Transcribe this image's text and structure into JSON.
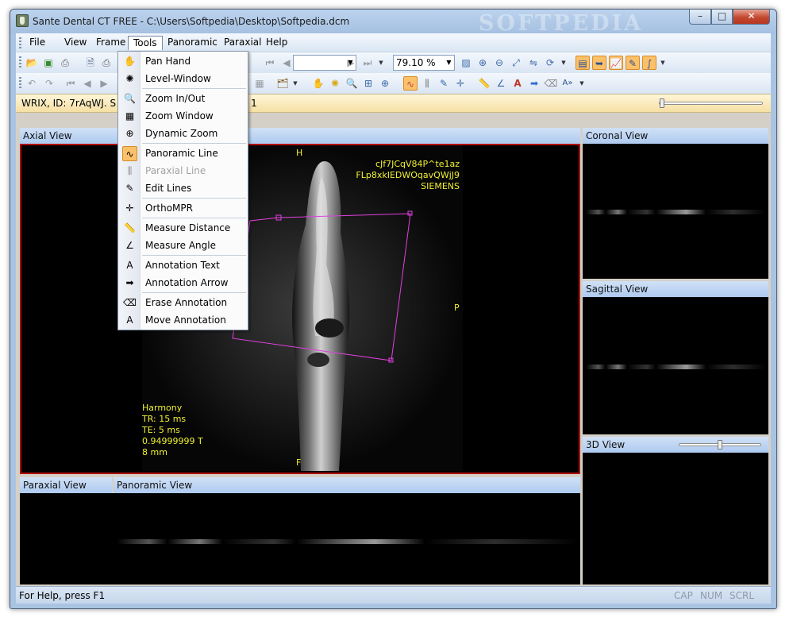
{
  "window": {
    "title": "Sante Dental CT FREE - C:\\Users\\Softpedia\\Desktop\\Softpedia.dcm",
    "watermark": "SOFTPEDIA",
    "min_label": "–",
    "max_label": "□",
    "close_label": "✕"
  },
  "menubar": {
    "items": [
      "File",
      "View",
      "Frame",
      "Tools",
      "Panoramic",
      "Paraxial",
      "Help"
    ],
    "active": "Tools"
  },
  "toolbar": {
    "zoom_value": "79.10 %",
    "frame_value": ""
  },
  "patient_bar": {
    "text": "WRIX, ID: 7rAqWJ.  S",
    "series_text": "s: 1",
    "slider_level": 0.01
  },
  "tools_menu": [
    {
      "icon": "hand-icon",
      "glyph": "✋",
      "label": "Pan Hand"
    },
    {
      "icon": "level-window-icon",
      "glyph": "✺",
      "label": "Level-Window"
    },
    {
      "icon": "zoom-in-out-icon",
      "glyph": "🔍",
      "label": "Zoom In/Out"
    },
    {
      "icon": "zoom-window-icon",
      "glyph": "▦",
      "label": "Zoom Window"
    },
    {
      "icon": "dynamic-zoom-icon",
      "glyph": "⊕",
      "label": "Dynamic Zoom"
    },
    {
      "icon": "panoramic-line-icon",
      "glyph": "∿",
      "label": "Panoramic Line",
      "selected": true
    },
    {
      "icon": "paraxial-line-icon",
      "glyph": "⫼",
      "label": "Paraxial Line",
      "disabled": true
    },
    {
      "icon": "edit-lines-icon",
      "glyph": "✎",
      "label": "Edit Lines"
    },
    {
      "icon": "orthompr-icon",
      "glyph": "✛",
      "label": "OrthoMPR"
    },
    {
      "icon": "measure-distance-icon",
      "glyph": "📏",
      "label": "Measure Distance"
    },
    {
      "icon": "measure-angle-icon",
      "glyph": "∠",
      "label": "Measure Angle"
    },
    {
      "icon": "annotation-text-icon",
      "glyph": "A",
      "label": "Annotation Text"
    },
    {
      "icon": "annotation-arrow-icon",
      "glyph": "➡",
      "label": "Annotation Arrow"
    },
    {
      "icon": "erase-annotation-icon",
      "glyph": "⌫",
      "label": "Erase Annotation"
    },
    {
      "icon": "move-annotation-icon",
      "glyph": "A",
      "label": "Move Annotation"
    }
  ],
  "axial": {
    "title": "Axial View",
    "label_top": "H",
    "label_bottom": "F",
    "label_right": "P",
    "info_right": [
      "cJf7JCqV84P^te1az",
      "FLp8xkIEDWOqavQWjJ9",
      "SIEMENS"
    ],
    "info_left": [
      "Harmony",
      "TR: 15 ms",
      "TE: 5 ms",
      "0.94999999 T",
      "8 mm"
    ]
  },
  "coronal": {
    "title": "Coronal View"
  },
  "sagittal": {
    "title": "Sagittal View"
  },
  "view3d": {
    "title": "3D View",
    "slider_level": 0.5
  },
  "paraxial": {
    "title": "Paraxial View"
  },
  "panoramic": {
    "title": "Panoramic View"
  },
  "status": {
    "help": "For Help, press F1",
    "cap": "CAP",
    "num": "NUM",
    "scrl": "SCRL"
  },
  "colors": {
    "accent": "#fbc06a",
    "overlay_text": "#f0f033",
    "panoramic_line": "#e040e0",
    "active_border": "#b01010"
  }
}
